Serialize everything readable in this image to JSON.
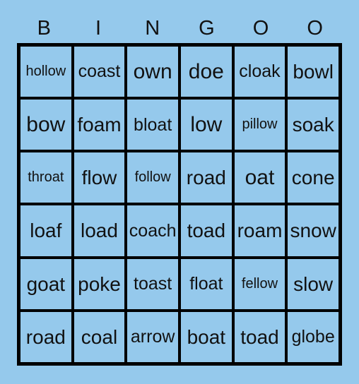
{
  "card": {
    "title_letters": [
      "B",
      "I",
      "N",
      "G",
      "O",
      "O"
    ],
    "background_color": "#95c9ec",
    "border_color": "#000000",
    "text_color": "#111111",
    "columns": 6,
    "rows": 6,
    "cells": [
      [
        "hollow",
        "coast",
        "own",
        "doe",
        "cloak",
        "bowl"
      ],
      [
        "bow",
        "foam",
        "bloat",
        "low",
        "pillow",
        "soak"
      ],
      [
        "throat",
        "flow",
        "follow",
        "road",
        "oat",
        "cone"
      ],
      [
        "loaf",
        "load",
        "coach",
        "toad",
        "roam",
        "snow"
      ],
      [
        "goat",
        "poke",
        "toast",
        "float",
        "fellow",
        "slow"
      ],
      [
        "road",
        "coal",
        "arrow",
        "boat",
        "toad",
        "globe"
      ]
    ]
  }
}
